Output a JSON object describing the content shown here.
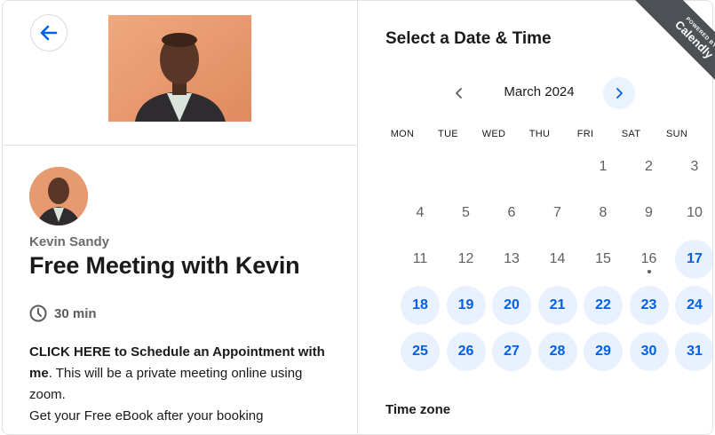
{
  "left_panel": {
    "host_name": "Kevin Sandy",
    "event_title": "Free Meeting with Kevin",
    "duration": "30 min",
    "description_bold": "CLICK HERE to Schedule an Appointment with me",
    "description_text": ". This will be a private meeting online using zoom.",
    "description_line2": "Get your Free eBook after your booking"
  },
  "right_panel": {
    "heading": "Select a Date & Time",
    "badge_small": "POWERED BY",
    "badge_brand": "Calendly",
    "month_label": "March 2024",
    "weekdays": [
      "MON",
      "TUE",
      "WED",
      "THU",
      "FRI",
      "SAT",
      "SUN"
    ],
    "days": [
      {
        "day": "1",
        "available": false
      },
      {
        "day": "2",
        "available": false
      },
      {
        "day": "3",
        "available": false
      },
      {
        "day": "4",
        "available": false
      },
      {
        "day": "5",
        "available": false
      },
      {
        "day": "6",
        "available": false
      },
      {
        "day": "7",
        "available": false
      },
      {
        "day": "8",
        "available": false
      },
      {
        "day": "9",
        "available": false
      },
      {
        "day": "10",
        "available": false
      },
      {
        "day": "11",
        "available": false
      },
      {
        "day": "12",
        "available": false
      },
      {
        "day": "13",
        "available": false
      },
      {
        "day": "14",
        "available": false
      },
      {
        "day": "15",
        "available": false
      },
      {
        "day": "16",
        "available": false,
        "today": true
      },
      {
        "day": "17",
        "available": true
      },
      {
        "day": "18",
        "available": true
      },
      {
        "day": "19",
        "available": true
      },
      {
        "day": "20",
        "available": true
      },
      {
        "day": "21",
        "available": true
      },
      {
        "day": "22",
        "available": true
      },
      {
        "day": "23",
        "available": true
      },
      {
        "day": "24",
        "available": true
      },
      {
        "day": "25",
        "available": true
      },
      {
        "day": "26",
        "available": true
      },
      {
        "day": "27",
        "available": true
      },
      {
        "day": "28",
        "available": true
      },
      {
        "day": "29",
        "available": true
      },
      {
        "day": "30",
        "available": true
      },
      {
        "day": "31",
        "available": true
      }
    ],
    "first_weekday_index": 4,
    "timezone_label": "Time zone"
  },
  "colors": {
    "accent": "#0060e6",
    "available_bg": "#e8f1fd",
    "badge_bg": "#4d5055"
  },
  "icons": {
    "back": "arrow-left-icon",
    "prev_month": "chevron-left-icon",
    "next_month": "chevron-right-icon",
    "duration": "clock-icon"
  }
}
